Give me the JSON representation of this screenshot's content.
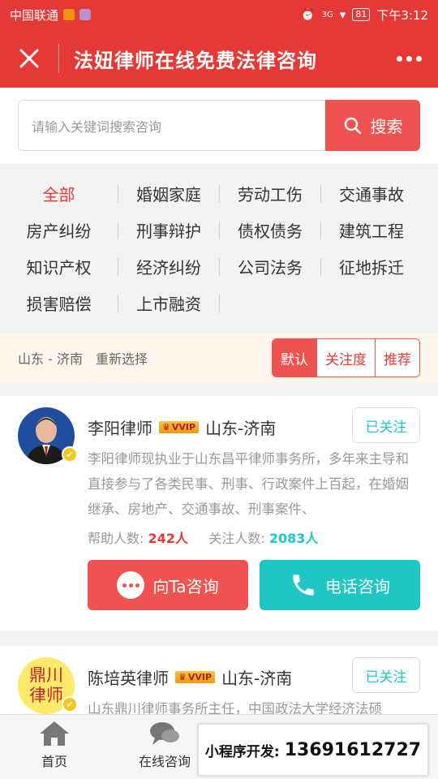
{
  "status_bar": {
    "carrier": "中国联通",
    "network": "3G",
    "battery": "81",
    "time": "下午3:12"
  },
  "header": {
    "title": "法妞律师在线免费法律咨询"
  },
  "search": {
    "placeholder": "请输入关键词搜索咨询",
    "button_label": "搜索"
  },
  "categories": [
    [
      "全部",
      "婚姻家庭",
      "劳动工伤",
      "交通事故"
    ],
    [
      "房产纠纷",
      "刑事辩护",
      "债权债务",
      "建筑工程"
    ],
    [
      "知识产权",
      "经济纠纷",
      "公司法务",
      "征地拆迁"
    ],
    [
      "损害赔偿",
      "上市融资"
    ]
  ],
  "filter": {
    "location": "山东 - 济南",
    "reselect": "重新选择",
    "sorts": [
      "默认",
      "关注度",
      "推荐"
    ]
  },
  "lawyers": [
    {
      "name": "李阳律师",
      "vip": "VVIP",
      "region": "山东-济南",
      "follow_label": "已关注",
      "description": "李阳律师现执业于山东昌平律师事务所，多年来主导和直接参与了各类民事、刑事、行政案件上百起，在婚姻继承、房地产、交通事故、刑事案件、",
      "helped_label": "帮助人数:",
      "helped_count": "242人",
      "followers_label": "关注人数:",
      "followers_count": "2083人",
      "consult_label": "向Ta咨询",
      "phone_label": "电话咨询"
    },
    {
      "name": "陈培英律师",
      "vip": "VVIP",
      "region": "山东-济南",
      "follow_label": "已关注",
      "avatar_text": "鼎川律师",
      "description": "山东鼎川律师事务所主任，中国政法大学经济法硕"
    }
  ],
  "tabbar": {
    "tabs": [
      "首页",
      "在线咨询"
    ]
  },
  "promo": {
    "label": "小程序开发:",
    "phone": "13691612727"
  },
  "colors": {
    "brand_red": "#e53935",
    "teal": "#1ec6c6"
  }
}
